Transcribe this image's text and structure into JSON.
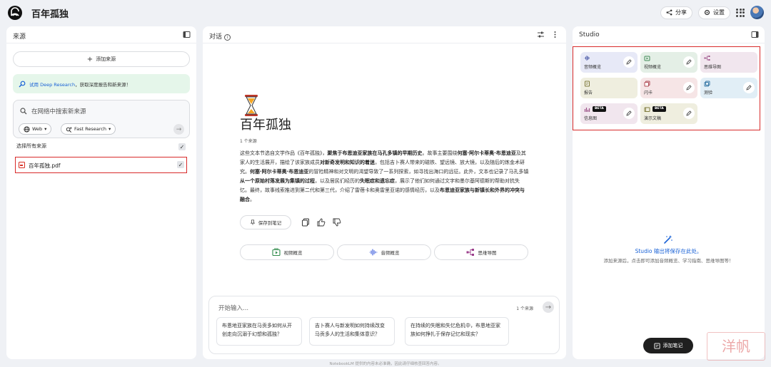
{
  "app": {
    "title": "百年孤独",
    "share_label": "分享",
    "settings_label": "设置"
  },
  "sources": {
    "title": "来源",
    "add_label": "添加来源",
    "deep_banner": {
      "link": "试用 Deep Research",
      "text": "，获取深度报告和新来源！"
    },
    "search_placeholder": "在网络中搜索新来源",
    "chip_web": "Web",
    "chip_research": "Fast Research",
    "select_all": "选择所有来源",
    "items": [
      {
        "name": "百年孤独.pdf"
      }
    ]
  },
  "chat": {
    "title": "对话",
    "notebook_title": "百年孤独",
    "source_count": "1 个来源",
    "summary": [
      {
        "t": "这些文本节选自文学作品《百年孤独》，",
        "b": false
      },
      {
        "t": "聚焦于布恩迪亚家族在马孔多镇的早期历史",
        "b": true
      },
      {
        "t": "。故事主要围绕",
        "b": false
      },
      {
        "t": "何塞·阿尔卡蒂奥·布恩迪亚",
        "b": true
      },
      {
        "t": "及其家人的生活展开，描绘了该家族成员",
        "b": false
      },
      {
        "t": "对新奇发明和知识的着迷",
        "b": true
      },
      {
        "t": "，包括吉卜赛人带来的磁铁、望远镜、放大镜，以及随后的炼金术研究。",
        "b": false
      },
      {
        "t": "何塞·阿尔卡蒂奥·布恩迪亚",
        "b": true
      },
      {
        "t": "的冒险精神和对文明的渴望导致了一系列探索，如寻找出海口的远征。此外，文本也记录了马孔多镇",
        "b": false
      },
      {
        "t": "从一个原始村落发展为集镇的过程",
        "b": true
      },
      {
        "t": "，以及居民们经历的",
        "b": false
      },
      {
        "t": "失眠症和遗忘症",
        "b": true
      },
      {
        "t": "，展示了他们如何通过文字和墨尔基阿德斯的帮助对抗失忆。最终，故事线索推进到第二代和第三代，介绍了雷蓓卡和奥雷里亚诺的感情经历，以及",
        "b": false
      },
      {
        "t": "布恩迪亚家族与新镇长和外界的冲突与融合",
        "b": true
      },
      {
        "t": "。",
        "b": false
      }
    ],
    "save_note_label": "保存到笔记",
    "overview_buttons": [
      "视频概览",
      "音频概览",
      "思维导图"
    ],
    "input_placeholder": "开始输入...",
    "input_source_count": "1 个来源",
    "suggestions": [
      "布恩地亚家族在马贡多如何从开创走向沉溺于幻想和孤独？",
      "吉卜赛人与新发明如何持续改变马贡多人的生活和集体意识？",
      "在持续的失眠和失忆危机中，布恩地亚家族如何挣扎于保存记忆和现实？"
    ]
  },
  "studio": {
    "title": "Studio",
    "tiles": [
      {
        "label": "音频概览",
        "bg": "#e7e9f7",
        "icon": "audio-wave-icon",
        "color": "#4c5ca8",
        "edit": true
      },
      {
        "label": "视频概览",
        "bg": "#e4efe6",
        "icon": "video-icon",
        "color": "#3f8a55",
        "edit": true
      },
      {
        "label": "思维导图",
        "bg": "#f1e6ee",
        "icon": "mindmap-icon",
        "color": "#9a4f86",
        "edit": false
      },
      {
        "label": "报告",
        "bg": "#efeedf",
        "icon": "report-icon",
        "color": "#7f7a3c",
        "edit": false
      },
      {
        "label": "闪卡",
        "bg": "#f6e5e6",
        "icon": "flashcard-icon",
        "color": "#b04b55",
        "edit": true
      },
      {
        "label": "测验",
        "bg": "#e1eef6",
        "icon": "quiz-icon",
        "color": "#3a7aa8",
        "edit": true
      },
      {
        "label": "信息图",
        "bg": "#f1e6ee",
        "icon": "infographic-icon",
        "color": "#9a4f86",
        "edit": true,
        "beta": "BETA"
      },
      {
        "label": "演示文稿",
        "bg": "#efeedf",
        "icon": "slides-icon",
        "color": "#7f7a3c",
        "edit": true,
        "beta": "BETA"
      }
    ],
    "empty_title": "Studio 输出将保存在此处。",
    "empty_sub": "添加来源后，点击即可添加音频概览、学习指南、思维导图等！",
    "add_note_label": "添加笔记"
  },
  "footer": "NotebookLM 提供的内容未必准确，因此请仔细核查回答内容。",
  "watermark": "洋帆"
}
